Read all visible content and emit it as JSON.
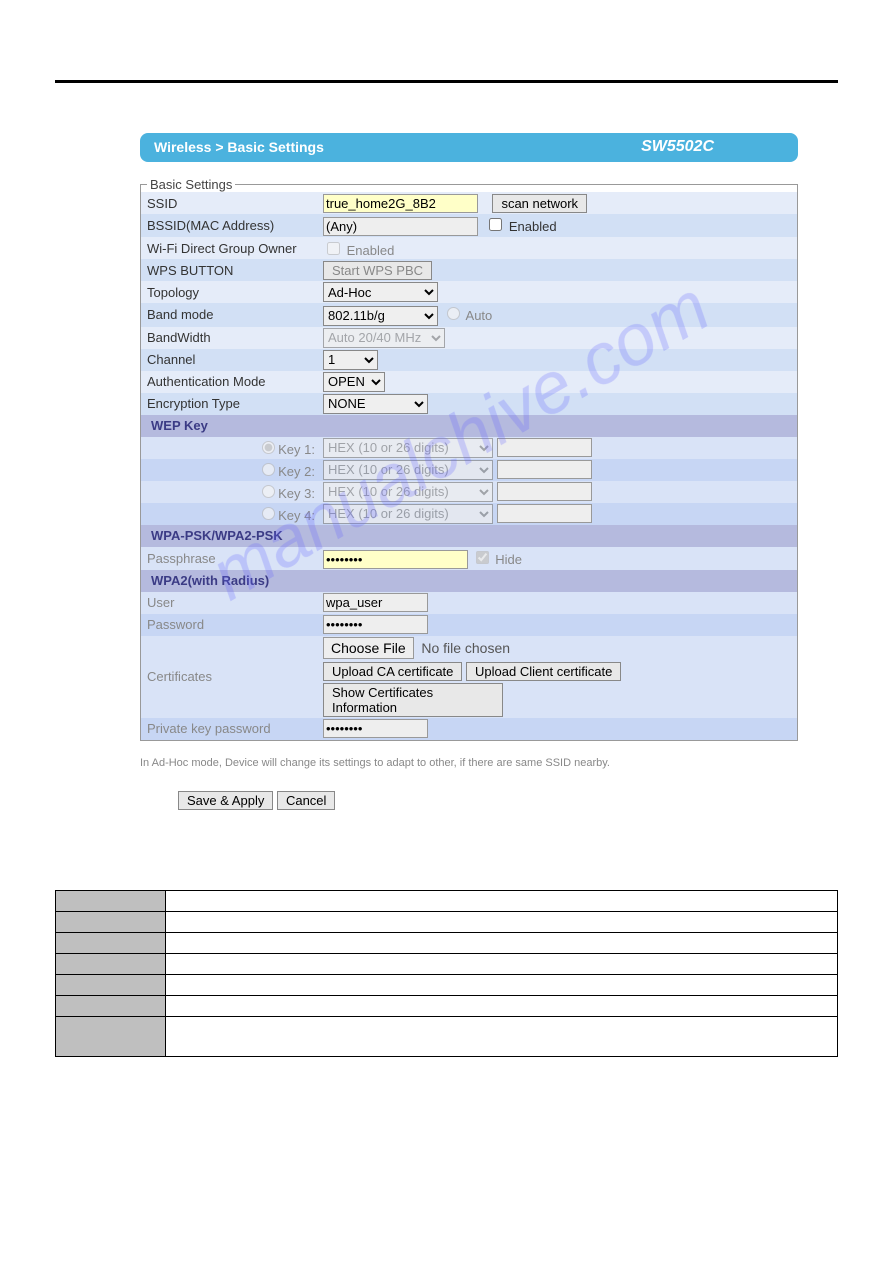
{
  "header": {
    "breadcrumb": "Wireless > Basic Settings",
    "model": "SW5502C"
  },
  "legend": "Basic Settings",
  "fields": {
    "ssid_label": "SSID",
    "ssid_value": "true_home2G_8B2",
    "scan_btn": "scan network",
    "bssid_label": "BSSID(MAC Address)",
    "bssid_value": "(Any)",
    "bssid_enabled": "Enabled",
    "wifi_direct_label": "Wi-Fi Direct Group Owner",
    "wifi_direct_enabled": "Enabled",
    "wps_label": "WPS BUTTON",
    "wps_btn": "Start WPS PBC",
    "topology_label": "Topology",
    "topology_value": "Ad-Hoc",
    "band_label": "Band mode",
    "band_value": "802.11b/g",
    "band_auto": "Auto",
    "bandwidth_label": "BandWidth",
    "bandwidth_value": "Auto 20/40 MHz",
    "channel_label": "Channel",
    "channel_value": "1",
    "auth_label": "Authentication Mode",
    "auth_value": "OPEN",
    "enc_label": "Encryption Type",
    "enc_value": "NONE"
  },
  "wep": {
    "heading": "WEP Key",
    "keys": [
      {
        "label": "Key 1:",
        "fmt": "HEX (10 or 26 digits)"
      },
      {
        "label": "Key 2:",
        "fmt": "HEX (10 or 26 digits)"
      },
      {
        "label": "Key 3:",
        "fmt": "HEX (10 or 26 digits)"
      },
      {
        "label": "Key 4:",
        "fmt": "HEX (10 or 26 digits)"
      }
    ]
  },
  "wpa": {
    "heading": "WPA-PSK/WPA2-PSK",
    "pass_label": "Passphrase",
    "pass_value": "••••••••",
    "hide": "Hide"
  },
  "radius": {
    "heading": "WPA2(with Radius)",
    "user_label": "User",
    "user_value": "wpa_user",
    "pwd_label": "Password",
    "pwd_value": "••••••••",
    "cert_label": "Certificates",
    "choose_file": "Choose File",
    "no_file": "No file chosen",
    "upload_ca": "Upload CA certificate",
    "upload_client": "Upload Client certificate",
    "show_cert": "Show Certificates Information",
    "pk_label": "Private key password",
    "pk_value": "••••••••"
  },
  "note": "In Ad-Hoc mode, Device will change its settings to adapt to other, if there are same SSID nearby.",
  "actions": {
    "save": "Save & Apply",
    "cancel": "Cancel"
  },
  "watermark": "manualchive.com"
}
